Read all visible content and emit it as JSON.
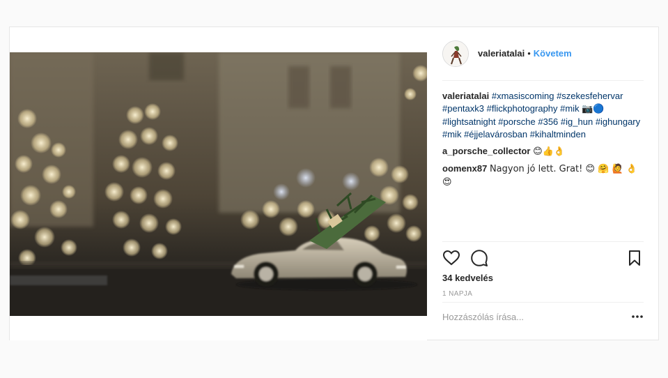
{
  "post": {
    "photo_alt": "",
    "header": {
      "username": "valeriatalai",
      "separator": "•",
      "follow_label": "Követem"
    },
    "caption": {
      "username": "valeriatalai",
      "tags": [
        "#xmasiscoming",
        "#szekesfehervar",
        "#pentaxk3",
        "#flickphotography",
        "#mik",
        "📷🔵",
        "#lightsatnight",
        "#porsche",
        "#356",
        "#ig_hun",
        "#ighungary",
        "#mik",
        "#éjjelavárosban",
        "#kihaltminden"
      ]
    },
    "comments": [
      {
        "username": "a_porsche_collector",
        "text": "😊👍👌"
      },
      {
        "username": "oomenx87",
        "text": "Nagyon jó lett. Grat! 😊 🤗 🙋 👌 😍"
      }
    ],
    "likes_label": "34 kedvelés",
    "time_label": "1 NAPJA",
    "comment_placeholder": "Hozzászólás írása...",
    "icons": [
      "heart-icon",
      "comment-icon",
      "bookmark-icon",
      "more-options-icon"
    ]
  }
}
